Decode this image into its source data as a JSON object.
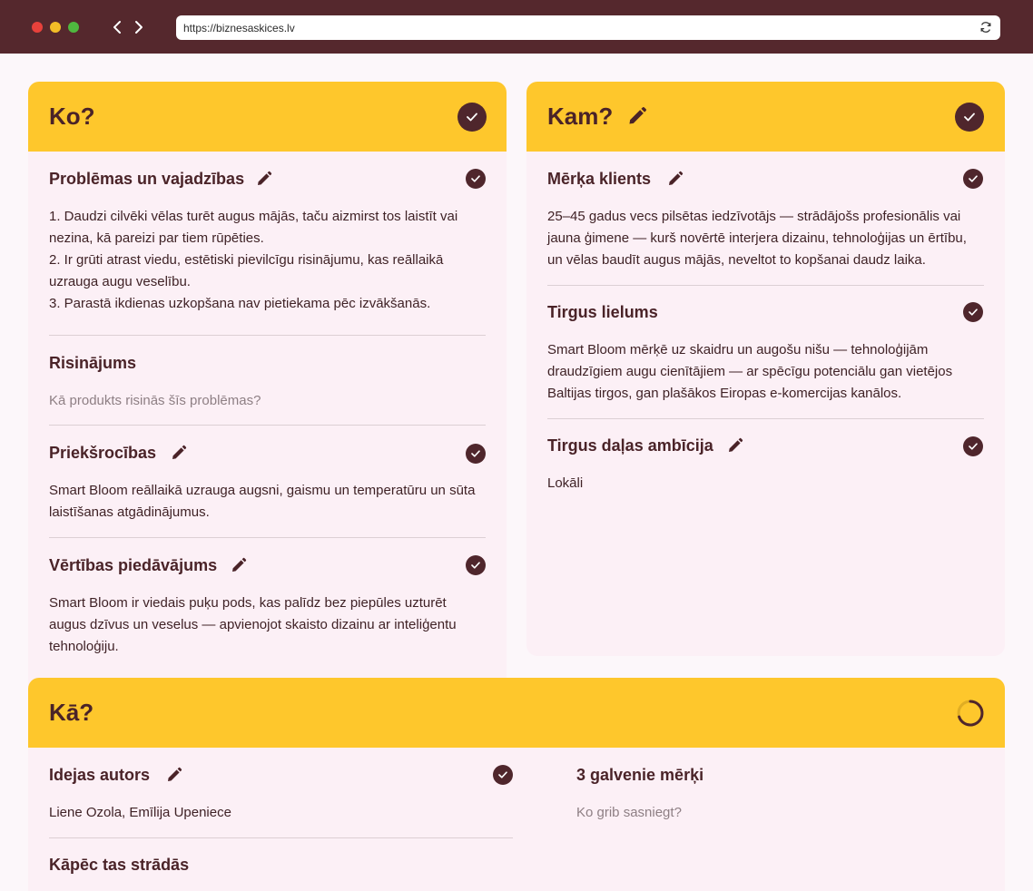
{
  "browser": {
    "url": "https://biznesaskices.lv",
    "icons": [
      "close-dot",
      "minimize-dot",
      "maximize-dot",
      "back-icon",
      "forward-icon",
      "reload-icon"
    ]
  },
  "colors": {
    "chrome": "#55282d",
    "accent": "#fec72c",
    "panel": "#fcf0f6",
    "text": "#4a2328"
  },
  "ko": {
    "title": "Ko?",
    "problems": {
      "title": "Problēmas un vajadzības",
      "items": [
        "1. Daudzi cilvēki vēlas turēt augus mājās, taču aizmirst tos laistīt vai nezina, kā pareizi par tiem rūpēties.",
        "2. Ir grūti atrast viedu, estētiski pievilcīgu risinājumu, kas reāllaikā uzrauga augu veselību.",
        "3. Parastā ikdienas uzkopšana nav pietiekama pēc izvākšanās."
      ]
    },
    "solution": {
      "title": "Risinājums",
      "placeholder": "Kā produkts risinās šīs problēmas?"
    },
    "advantages": {
      "title": "Priekšrocības",
      "text": "Smart Bloom reāllaikā uzrauga augsni, gaismu un temperatūru un sūta laistīšanas atgādinājumus."
    },
    "value": {
      "title": "Vērtības piedāvājums",
      "text": "Smart Bloom ir viedais puķu pods, kas palīdz bez piepūles uzturēt augus dzīvus un veselus — apvienojot skaisto dizainu ar inteliģentu tehnoloģiju."
    }
  },
  "kam": {
    "title": "Kam?",
    "target": {
      "title": "Mērķa klients",
      "text": "25–45 gadus vecs pilsētas iedzīvotājs — strādājošs profesionālis vai jauna ģimene — kurš novērtē interjera dizainu, tehnoloģijas un ērtību, un vēlas baudīt augus mājās, neveltot to kopšanai daudz laika."
    },
    "market": {
      "title": "Tirgus lielums",
      "text": "Smart Bloom mērķē uz skaidru un augošu nišu — tehnoloģijām draudzīgiem augu cienītājiem — ar spēcīgu potenciālu gan vietējos Baltijas tirgos, gan plašākos Eiropas e-komercijas kanālos."
    },
    "share": {
      "title": "Tirgus daļas ambīcija",
      "text": "Lokāli"
    }
  },
  "ka": {
    "title": "Kā?",
    "author": {
      "title": "Idejas autors",
      "text": "Liene Ozola, Emīlija Upeniece"
    },
    "why": {
      "title": "Kāpēc tas strādās"
    },
    "goals": {
      "title": "3 galvenie mērķi",
      "placeholder": "Ko grib sasniegt?"
    }
  }
}
